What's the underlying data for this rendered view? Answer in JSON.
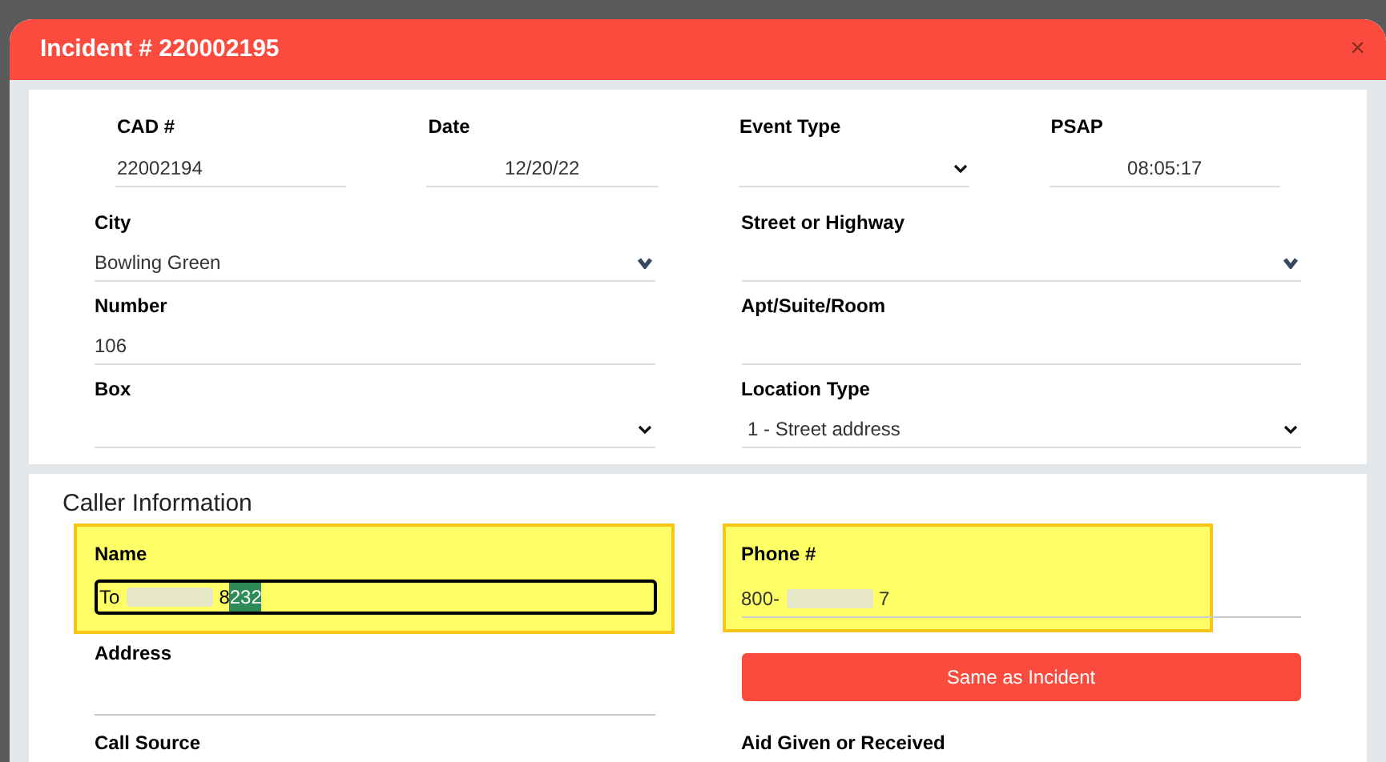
{
  "modal": {
    "title": "Incident # 220002195",
    "close": "×"
  },
  "incident": {
    "top_fields": [
      {
        "label": "CAD #",
        "value": "22002194",
        "kind": "text"
      },
      {
        "label": "Date",
        "value": "12/20/22",
        "kind": "date"
      },
      {
        "label": "Event Type",
        "kind": "select"
      },
      {
        "label": "PSAP",
        "value": "08:05:17",
        "kind": "time"
      }
    ],
    "fields": [
      {
        "label": "City",
        "value": "Bowling Green",
        "kind": "combo"
      },
      {
        "label": "Street or Highway",
        "kind": "combo"
      },
      {
        "label": "Number",
        "value": "106",
        "kind": "text"
      },
      {
        "label": "Apt/Suite/Room",
        "kind": "text"
      },
      {
        "label": "Box",
        "kind": "select"
      },
      {
        "label": "Location Type",
        "value": "1 - Street address",
        "kind": "select"
      }
    ]
  },
  "caller": {
    "heading": "Caller Information",
    "name": {
      "label": "Name",
      "value_start": "To",
      "value_middle": "8",
      "value_selected": "232",
      "focused": true,
      "highlighted": true
    },
    "phone": {
      "label": "Phone #",
      "value_start": "800-",
      "value_end": "7",
      "highlighted": true
    },
    "address": {
      "label": "Address"
    },
    "same_button": "Same as Incident",
    "call_source": {
      "label": "Call Source"
    },
    "aid": {
      "label": "Aid Given or Received"
    }
  }
}
